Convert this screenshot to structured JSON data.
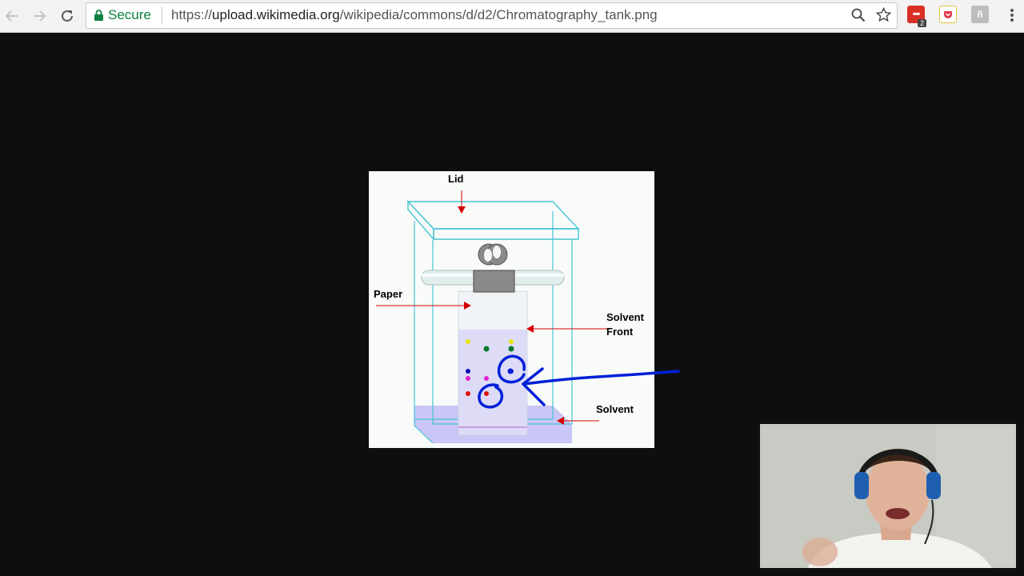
{
  "browser": {
    "security_label": "Secure",
    "url_scheme": "https://",
    "url_host": "upload.wikimedia.org",
    "url_path": "/wikipedia/commons/d/d2/Chromatography_tank.png",
    "extension_badge": "2"
  },
  "image": {
    "labels": {
      "lid": "Lid",
      "paper": "Paper",
      "solvent_front_1": "Solvent",
      "solvent_front_2": "Front",
      "solvent": "Solvent"
    },
    "colors": {
      "tank_outline": "#46c4d4",
      "solvent": "#c4c0f4",
      "arrow": "#d40000",
      "annotation": "#0020d8",
      "clip": "#8a8a8a"
    }
  }
}
